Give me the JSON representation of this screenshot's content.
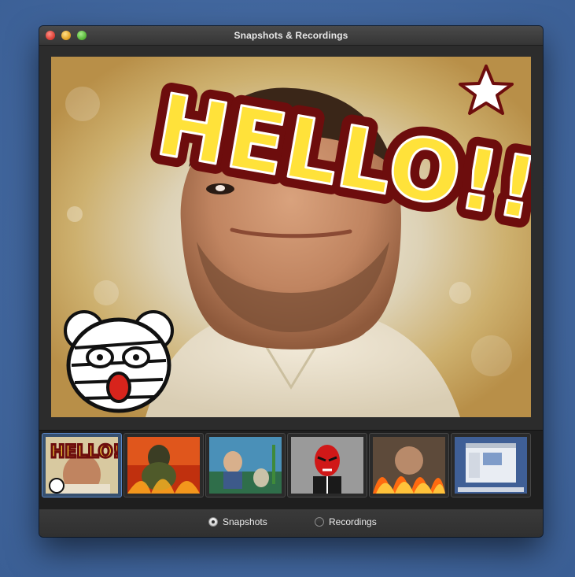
{
  "window": {
    "title": "Snapshots & Recordings"
  },
  "preview": {
    "overlay_text": "HELLO!!"
  },
  "thumbnails": [
    {
      "label": "HELLO!!",
      "kind": "hello-face",
      "selected": true
    },
    {
      "label": "",
      "kind": "fire-portrait",
      "selected": false
    },
    {
      "label": "",
      "kind": "aquarium-boy",
      "selected": false
    },
    {
      "label": "",
      "kind": "opera-mask",
      "selected": false
    },
    {
      "label": "",
      "kind": "flames-collage",
      "selected": false
    },
    {
      "label": "",
      "kind": "desktop-screenshot",
      "selected": false
    }
  ],
  "bottom": {
    "snapshots_label": "Snapshots",
    "recordings_label": "Recordings",
    "selected": "Snapshots"
  },
  "colors": {
    "accent": "#5a86c6",
    "desktop": "#42679e",
    "hello_fill": "#ffe23a",
    "hello_outline": "#6d0d0d"
  }
}
